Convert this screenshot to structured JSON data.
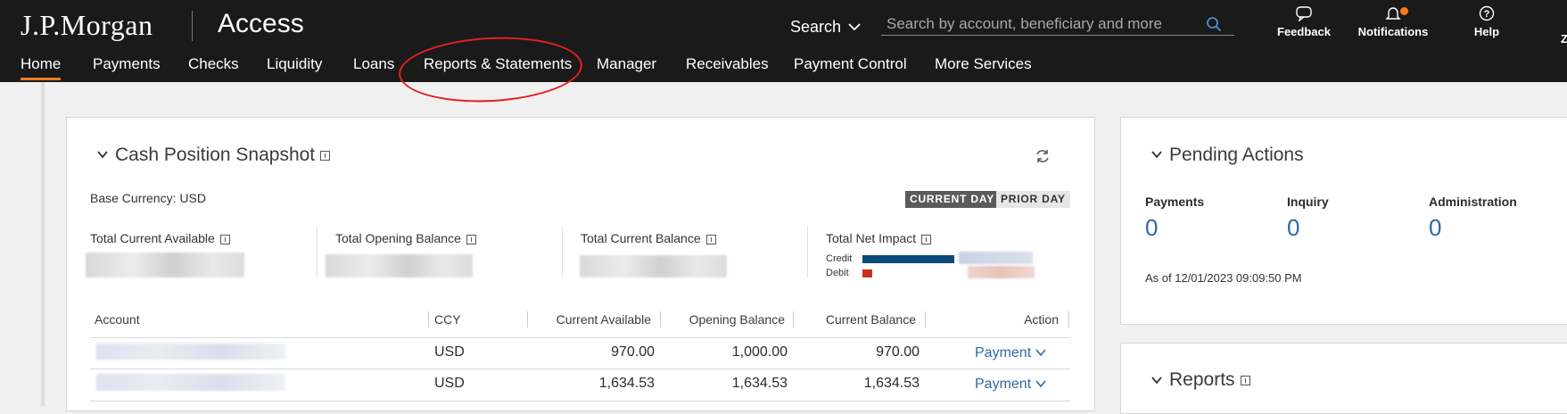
{
  "header": {
    "logo": "J.P.Morgan",
    "product": "Access",
    "search_label": "Search",
    "search_placeholder": "Search by account, beneficiary and more",
    "feedback": "Feedback",
    "notifications": "Notifications",
    "help": "Help",
    "edge_item": "Z"
  },
  "nav": {
    "items": [
      "Home",
      "Payments",
      "Checks",
      "Liquidity",
      "Loans",
      "Reports & Statements",
      "Manager",
      "Receivables",
      "Payment Control",
      "More Services"
    ],
    "active": "Home"
  },
  "colors": {
    "accent": "#f07c1e",
    "link": "#2d6aa3",
    "credit": "#0b4a7a",
    "debit": "#c7321d",
    "annotation": "#e5201e"
  },
  "cash_snapshot": {
    "title": "Cash Position Snapshot",
    "base_currency": "Base Currency: USD",
    "toggle_current": "CURRENT DAY",
    "toggle_prior": "PRIOR DAY",
    "metrics": [
      "Total Current Available",
      "Total Opening Balance",
      "Total Current Balance",
      "Total Net Impact"
    ],
    "credit_label": "Credit",
    "debit_label": "Debit",
    "columns": [
      "Account",
      "CCY",
      "Current Available",
      "Opening Balance",
      "Current Balance",
      "Action"
    ],
    "rows": [
      {
        "ccy": "USD",
        "current_available": "970.00",
        "opening_balance": "1,000.00",
        "current_balance": "970.00",
        "action": "Payment"
      },
      {
        "ccy": "USD",
        "current_available": "1,634.53",
        "opening_balance": "1,634.53",
        "current_balance": "1,634.53",
        "action": "Payment"
      }
    ]
  },
  "pending_actions": {
    "title": "Pending Actions",
    "items": [
      {
        "label": "Payments",
        "value": "0"
      },
      {
        "label": "Inquiry",
        "value": "0"
      },
      {
        "label": "Administration",
        "value": "0"
      }
    ],
    "as_of": "As of 12/01/2023 09:09:50 PM"
  },
  "reports": {
    "title": "Reports"
  }
}
